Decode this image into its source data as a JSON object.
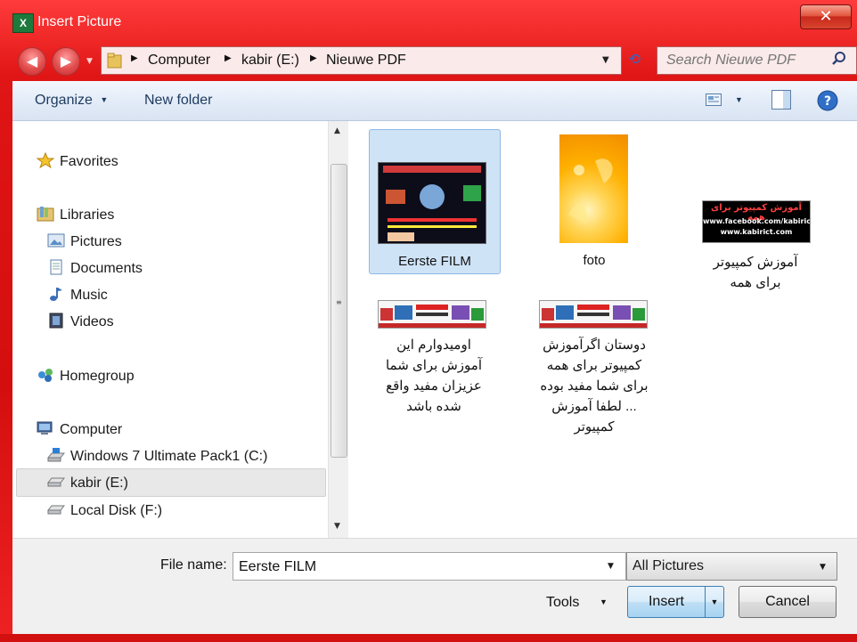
{
  "window": {
    "title": "Insert Picture",
    "app_icon_text": "X",
    "close_glyph": "✕",
    "accent_color": "#e01515"
  },
  "address_bar": {
    "crumbs": [
      "Computer",
      "kabir (E:)",
      "Nieuwe PDF"
    ],
    "separator": "▶",
    "dropdown_glyph": "▼",
    "refresh_glyph": "⟲",
    "back_glyph": "◀",
    "forward_glyph": "▶"
  },
  "search": {
    "placeholder": "Search Nieuwe PDF",
    "icon": "search-icon"
  },
  "toolbar": {
    "organize_label": "Organize",
    "organize_arrow": "▼",
    "new_folder_label": "New folder",
    "view_arrow": "▼",
    "help_glyph": "?"
  },
  "nav_pane": {
    "favorites": "Favorites",
    "libraries": "Libraries",
    "library_items": [
      "Pictures",
      "Documents",
      "Music",
      "Videos"
    ],
    "homegroup": "Homegroup",
    "computer": "Computer",
    "drives": [
      "Windows 7 Ultimate Pack1 (C:)",
      "kabir (E:)",
      "Local Disk (F:)"
    ],
    "selected": "kabir (E:)"
  },
  "scrollbar": {
    "up": "▲",
    "down": "▼",
    "grip": "≡"
  },
  "files": [
    {
      "name": "Eerste FILM",
      "selected": true
    },
    {
      "name": "foto",
      "selected": false
    },
    {
      "name": "آموزش کمپیوتر برای همه",
      "selected": false
    },
    {
      "name": "اومیدوارم این آموزش برای شما عزیزان مفید واقع شده باشد",
      "selected": false
    },
    {
      "name": "دوستان اگرآموزش کمپیوتر برای همه برای شما مفید بوده ... لطفا آموزش کمپیوتر",
      "selected": false
    }
  ],
  "banner_text": {
    "title": "آموزش کمپیوتر برای همه",
    "line1": "www.facebook.com/kabirict",
    "line2": "www.kabirict.com"
  },
  "bottom": {
    "file_name_label": "File name:",
    "file_name_value": "Eerste FILM",
    "filter_value": "All Pictures",
    "tools_label": "Tools",
    "insert_label": "Insert",
    "cancel_label": "Cancel",
    "dropdown_glyph": "▼"
  }
}
